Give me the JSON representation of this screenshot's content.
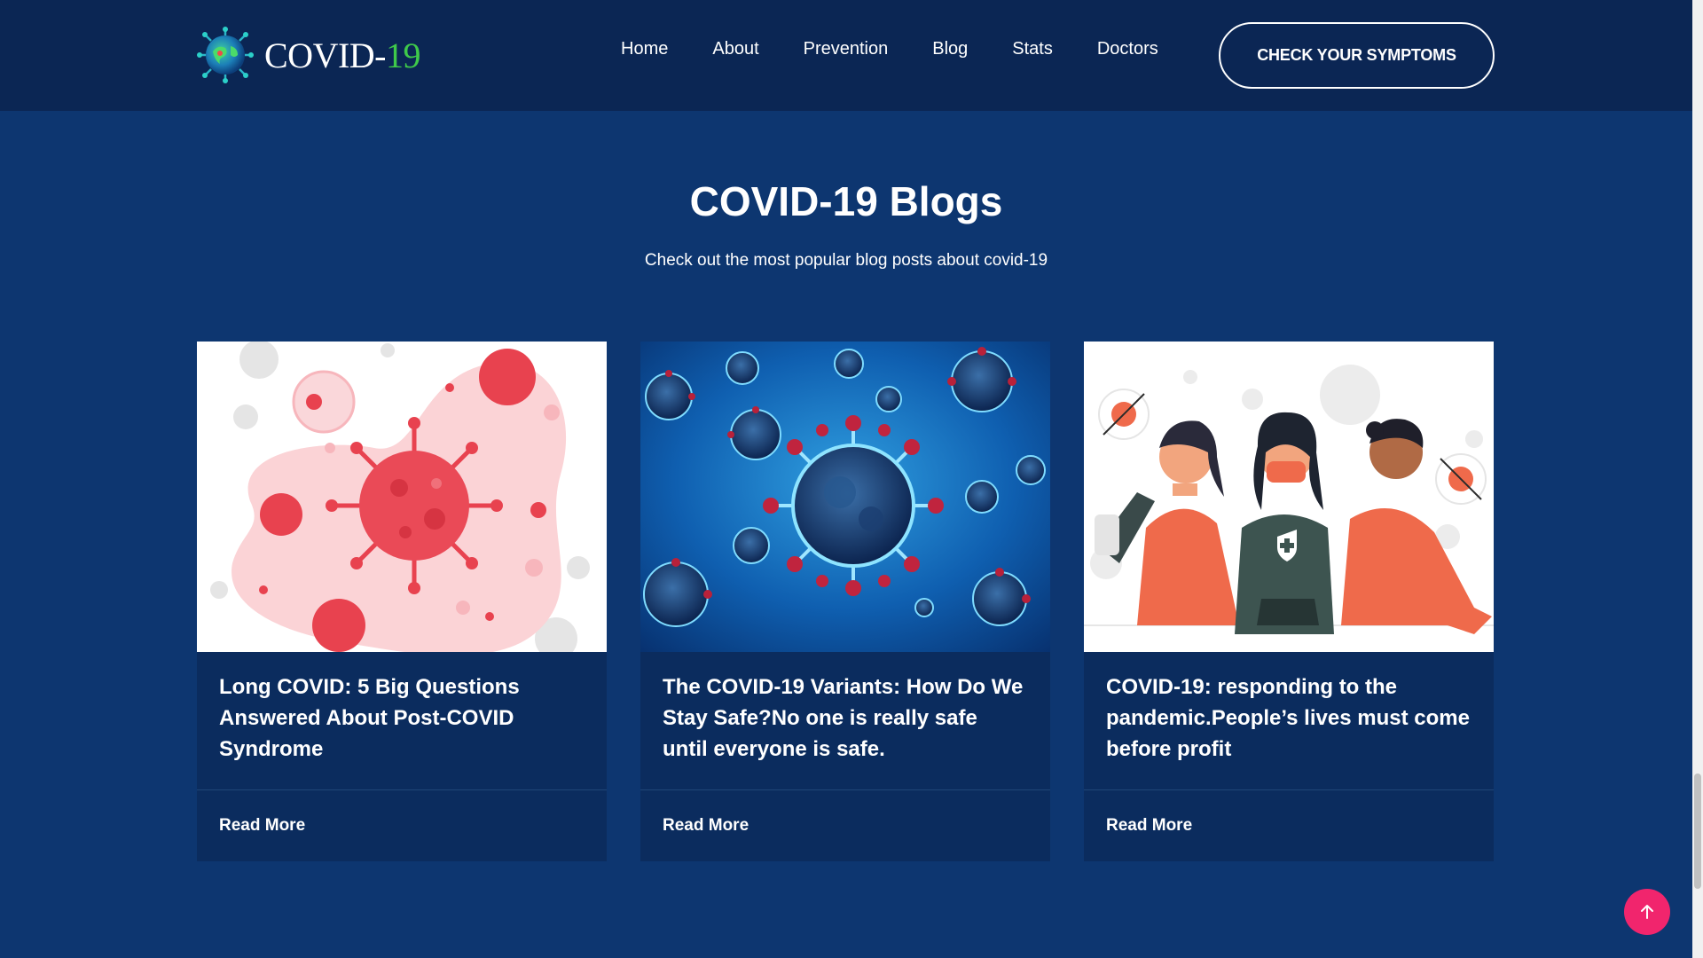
{
  "brand": {
    "name_main": "COVID-",
    "name_accent": "19",
    "accent_color": "#3fc94a",
    "icon": "virus-globe-icon"
  },
  "nav": {
    "items": [
      {
        "label": "Home"
      },
      {
        "label": "About"
      },
      {
        "label": "Prevention"
      },
      {
        "label": "Blog"
      },
      {
        "label": "Stats"
      },
      {
        "label": "Doctors"
      }
    ],
    "cta_label": "CHECK YOUR SYMPTOMS"
  },
  "section": {
    "title": "COVID-19 Blogs",
    "subtitle": "Check out the most popular blog posts about covid-19"
  },
  "posts": [
    {
      "title": "Long COVID: 5 Big Questions Answered About Post-COVID Syndrome",
      "read_more": "Read More",
      "image": "red-virus-illustration"
    },
    {
      "title": "The COVID-19 Variants: How Do We Stay Safe?No one is really safe until everyone is safe.",
      "read_more": "Read More",
      "image": "blue-coronavirus-render"
    },
    {
      "title": "COVID-19: responding to the pandemic.People’s lives must come before profit",
      "read_more": "Read More",
      "image": "people-wearing-masks-illustration"
    }
  ],
  "colors": {
    "header_bg": "#0b2654",
    "page_bg": "#0d3670",
    "card_bg": "#0b2c5e",
    "back_to_top": "#f1256d"
  },
  "back_to_top_icon": "arrow-up-icon"
}
